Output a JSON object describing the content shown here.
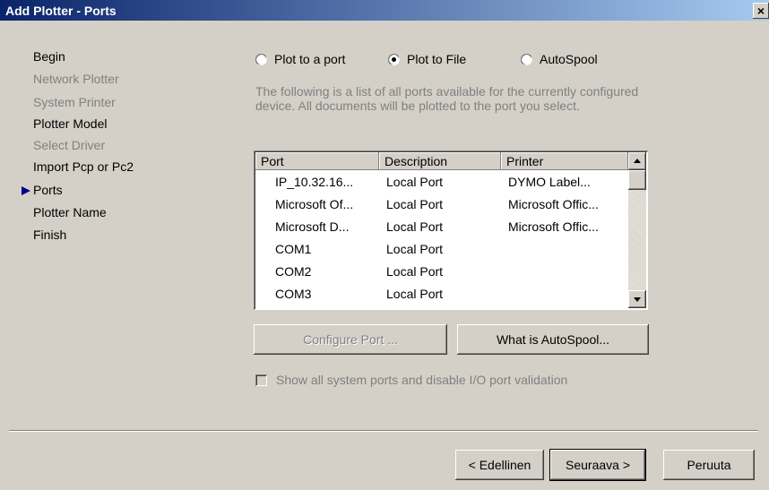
{
  "window": {
    "title": "Add Plotter - Ports",
    "close_label": "×"
  },
  "nav": {
    "items": [
      {
        "label": "Begin",
        "state": "done"
      },
      {
        "label": "Network Plotter",
        "state": "disabled"
      },
      {
        "label": "System Printer",
        "state": "disabled"
      },
      {
        "label": "Plotter Model",
        "state": "done"
      },
      {
        "label": "Select Driver",
        "state": "disabled"
      },
      {
        "label": "Import Pcp or Pc2",
        "state": "done"
      },
      {
        "label": "Ports",
        "state": "current"
      },
      {
        "label": "Plotter Name",
        "state": "pending"
      },
      {
        "label": "Finish",
        "state": "pending"
      }
    ]
  },
  "mode": {
    "options": [
      {
        "label": "Plot to a port",
        "checked": false
      },
      {
        "label": "Plot to File",
        "checked": true
      },
      {
        "label": "AutoSpool",
        "checked": false
      }
    ]
  },
  "description": "The following is a list of all ports available for the currently configured device. All documents will be plotted to the port you select.",
  "ports_table": {
    "columns": [
      "Port",
      "Description",
      "Printer"
    ],
    "rows": [
      [
        "IP_10.32.16...",
        "Local Port",
        "DYMO Label..."
      ],
      [
        "Microsoft Of...",
        "Local Port",
        "Microsoft Offic..."
      ],
      [
        "Microsoft D...",
        "Local Port",
        "Microsoft Offic..."
      ],
      [
        "COM1",
        "Local Port",
        ""
      ],
      [
        "COM2",
        "Local Port",
        ""
      ],
      [
        "COM3",
        "Local Port",
        ""
      ]
    ]
  },
  "buttons": {
    "configure_port": "Configure Port ...",
    "what_is_autospool": "What is AutoSpool...",
    "back": "< Edellinen",
    "next": "Seuraava >",
    "cancel": "Peruuta"
  },
  "show_all_ports": {
    "label": "Show all system ports and disable I/O port validation",
    "checked": false,
    "enabled": false
  }
}
